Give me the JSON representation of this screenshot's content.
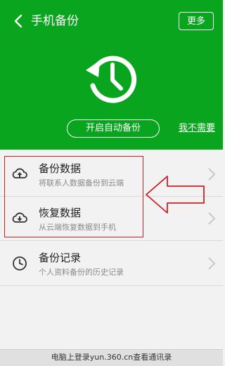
{
  "header": {
    "title": "手机备份",
    "more_label": "更多",
    "auto_backup_label": "开启自动备份",
    "no_need_label": "我不需要"
  },
  "list": {
    "items": [
      {
        "title": "备份数据",
        "subtitle": "将联系人数据备份到云端",
        "icon": "cloud-upload-icon"
      },
      {
        "title": "恢复数据",
        "subtitle": "从云端恢复数据到手机",
        "icon": "cloud-download-icon"
      },
      {
        "title": "备份记录",
        "subtitle": "个人资料备份的历史记录",
        "icon": "clock-icon"
      }
    ]
  },
  "footer": {
    "text": "电脑上登录yun.360.cn查看通讯录"
  },
  "colors": {
    "header_green": "#0aa51f",
    "annotation_red": "#cc1f2a"
  }
}
